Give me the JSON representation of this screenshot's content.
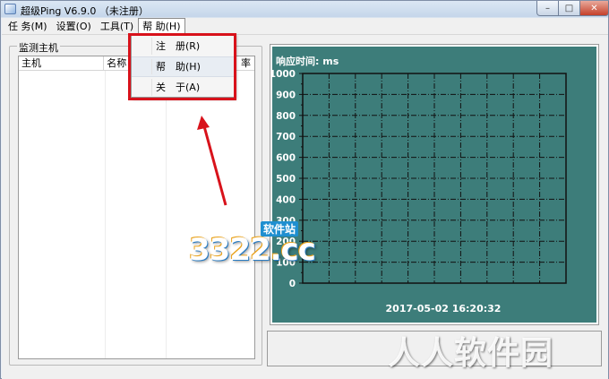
{
  "window": {
    "title": "超级Ping V6.9.0 （未注册）",
    "minimize": "–",
    "maximize": "□",
    "close": "✕"
  },
  "menubar": {
    "items": [
      {
        "label": "任 务(M)"
      },
      {
        "label": "设置(O)"
      },
      {
        "label": "工具(T)"
      },
      {
        "label": "帮 助(H)"
      }
    ]
  },
  "help_menu": {
    "items": [
      {
        "label": "注　册(R)"
      },
      {
        "label": "帮　助(H)"
      },
      {
        "label": "关　于(A)"
      }
    ]
  },
  "monitor": {
    "group_label": "监测主机",
    "columns": [
      "主机",
      "名称",
      "率"
    ]
  },
  "chart_data": {
    "type": "line",
    "title": "响应时间: ms",
    "yticks": [
      0,
      100,
      200,
      300,
      400,
      500,
      600,
      700,
      800,
      900,
      1000
    ],
    "ylim": [
      0,
      1000
    ],
    "grid": true,
    "xlabel": "2017-05-02    16:20:32",
    "series": []
  },
  "colors": {
    "chart_bg": "#3d7d7a",
    "highlight": "#d8121b"
  },
  "watermarks": {
    "logo_3322": "3322.cc",
    "logo_3322_sub": "软件站",
    "renren": "人人软件园"
  }
}
